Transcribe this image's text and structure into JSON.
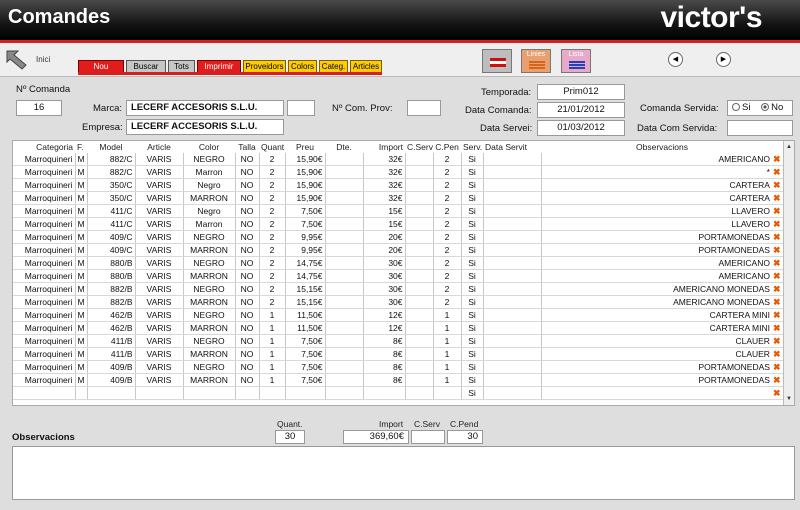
{
  "window": {
    "title": "Comandes",
    "brand": "victor's"
  },
  "toolbar": {
    "inici": "Inici",
    "buttons": [
      "Nou",
      "Buscar",
      "Tots",
      "Imprimir",
      "Proveidors",
      "Colors",
      "Categ.",
      "Articles"
    ],
    "linies": "Linies",
    "lista": "Lista"
  },
  "form": {
    "num_comanda_label": "Nº Comanda",
    "num_comanda": "16",
    "marca_label": "Marca:",
    "marca": "LECERF ACCESORIS S.L.U.",
    "empresa_label": "Empresa:",
    "empresa": "LECERF ACCESORIS S.L.U.",
    "num_com_prov_label": "Nº Com. Prov:",
    "num_com_prov": "",
    "temporada_label": "Temporada:",
    "temporada": "Prim012",
    "data_comanda_label": "Data Comanda:",
    "data_comanda": "21/01/2012",
    "data_servei_label": "Data Servei:",
    "data_servei": "01/03/2012",
    "comanda_servida_label": "Comanda Servida:",
    "si": "Si",
    "no": "No",
    "servida_selected": "No",
    "data_com_servida_label": "Data Com Servida:",
    "data_com_servida": ""
  },
  "grid": {
    "headers": [
      "Categoria",
      "F.",
      "Model",
      "Article",
      "Color",
      "Talla",
      "Quant.",
      "Preu",
      "Dte.",
      "Import",
      "C.Serv",
      "C.Pen",
      "Serv.",
      "Data Servit",
      "Observacions"
    ],
    "rows": [
      [
        "Marroquineri",
        "M",
        "882/C",
        "VARIS",
        "NEGRO",
        "NO",
        "2",
        "15,90€",
        "",
        "32€",
        "",
        "2",
        "Si",
        "",
        "AMERICANO"
      ],
      [
        "Marroquineri",
        "M",
        "882/C",
        "VARIS",
        "Marron",
        "NO",
        "2",
        "15,90€",
        "",
        "32€",
        "",
        "2",
        "Si",
        "",
        "*"
      ],
      [
        "Marroquineri",
        "M",
        "350/C",
        "VARIS",
        "Negro",
        "NO",
        "2",
        "15,90€",
        "",
        "32€",
        "",
        "2",
        "Si",
        "",
        "CARTERA"
      ],
      [
        "Marroquineri",
        "M",
        "350/C",
        "VARIS",
        "MARRON",
        "NO",
        "2",
        "15,90€",
        "",
        "32€",
        "",
        "2",
        "Si",
        "",
        "CARTERA"
      ],
      [
        "Marroquineri",
        "M",
        "411/C",
        "VARIS",
        "Negro",
        "NO",
        "2",
        "7,50€",
        "",
        "15€",
        "",
        "2",
        "Si",
        "",
        "LLAVERO"
      ],
      [
        "Marroquineri",
        "M",
        "411/C",
        "VARIS",
        "Marron",
        "NO",
        "2",
        "7,50€",
        "",
        "15€",
        "",
        "2",
        "Si",
        "",
        "LLAVERO"
      ],
      [
        "Marroquineri",
        "M",
        "409/C",
        "VARIS",
        "NEGRO",
        "NO",
        "2",
        "9,95€",
        "",
        "20€",
        "",
        "2",
        "Si",
        "",
        "PORTAMONEDAS"
      ],
      [
        "Marroquineri",
        "M",
        "409/C",
        "VARIS",
        "MARRON",
        "NO",
        "2",
        "9,95€",
        "",
        "20€",
        "",
        "2",
        "Si",
        "",
        "PORTAMONEDAS"
      ],
      [
        "Marroquineri",
        "M",
        "880/B",
        "VARIS",
        "NEGRO",
        "NO",
        "2",
        "14,75€",
        "",
        "30€",
        "",
        "2",
        "Si",
        "",
        "AMERICANO"
      ],
      [
        "Marroquineri",
        "M",
        "880/B",
        "VARIS",
        "MARRON",
        "NO",
        "2",
        "14,75€",
        "",
        "30€",
        "",
        "2",
        "Si",
        "",
        "AMERICANO"
      ],
      [
        "Marroquineri",
        "M",
        "882/B",
        "VARIS",
        "NEGRO",
        "NO",
        "2",
        "15,15€",
        "",
        "30€",
        "",
        "2",
        "Si",
        "",
        "AMERICANO MONEDAS"
      ],
      [
        "Marroquineri",
        "M",
        "882/B",
        "VARIS",
        "MARRON",
        "NO",
        "2",
        "15,15€",
        "",
        "30€",
        "",
        "2",
        "Si",
        "",
        "AMERICANO MONEDAS"
      ],
      [
        "Marroquineri",
        "M",
        "462/B",
        "VARIS",
        "NEGRO",
        "NO",
        "1",
        "11,50€",
        "",
        "12€",
        "",
        "1",
        "Si",
        "",
        "CARTERA MINI"
      ],
      [
        "Marroquineri",
        "M",
        "462/B",
        "VARIS",
        "MARRON",
        "NO",
        "1",
        "11,50€",
        "",
        "12€",
        "",
        "1",
        "Si",
        "",
        "CARTERA MINI"
      ],
      [
        "Marroquineri",
        "M",
        "411/B",
        "VARIS",
        "NEGRO",
        "NO",
        "1",
        "7,50€",
        "",
        "8€",
        "",
        "1",
        "Si",
        "",
        "CLAUER"
      ],
      [
        "Marroquineri",
        "M",
        "411/B",
        "VARIS",
        "MARRON",
        "NO",
        "1",
        "7,50€",
        "",
        "8€",
        "",
        "1",
        "Si",
        "",
        "CLAUER"
      ],
      [
        "Marroquineri",
        "M",
        "409/B",
        "VARIS",
        "NEGRO",
        "NO",
        "1",
        "7,50€",
        "",
        "8€",
        "",
        "1",
        "Si",
        "",
        "PORTAMONEDAS"
      ],
      [
        "Marroquineri",
        "M",
        "409/B",
        "VARIS",
        "MARRON",
        "NO",
        "1",
        "7,50€",
        "",
        "8€",
        "",
        "1",
        "Si",
        "",
        "PORTAMONEDAS"
      ],
      [
        "",
        "",
        "",
        "",
        "",
        "",
        "",
        "",
        "",
        "",
        "",
        "",
        "Si",
        "",
        ""
      ]
    ]
  },
  "totals": {
    "quant_label": "Quant.",
    "quant": "30",
    "import_label": "Import",
    "import": "369,60€",
    "cserv_label": "C.Serv",
    "cserv": "",
    "cpend_label": "C.Pend",
    "cpend": "30"
  },
  "observacions": {
    "label": "Observacions",
    "text": ""
  },
  "colors": {
    "accent": "#d62020",
    "yellow": "#ffcc00",
    "delete_icon": "#e85b00"
  },
  "icons": {
    "back": "back-arrow-icon",
    "flag": "flag-icon",
    "delete": "delete-x-icon",
    "prev": "prev-circle-icon",
    "next": "next-circle-icon"
  }
}
